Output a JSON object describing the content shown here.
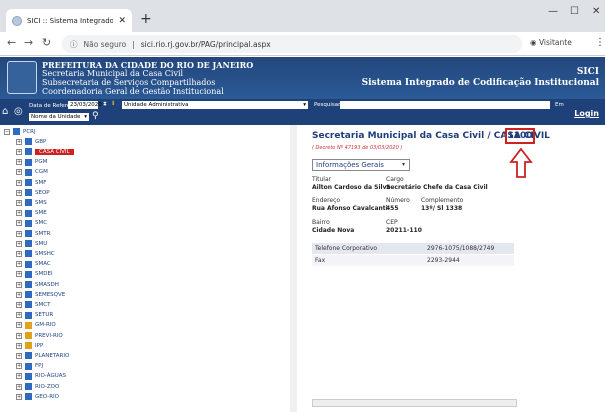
{
  "browser": {
    "tab_title": "SICI :: Sistema Integrado de Codi",
    "security": "Não seguro",
    "url": "sici.rio.rj.gov.br/PAG/principal.aspx",
    "profile": "Visitante"
  },
  "banner": {
    "line1": "PREFEITURA DA CIDADE DO RIO DE JANEIRO",
    "line2": "Secretaria Municipal da Casa Civil",
    "line3": "Subsecretaria de Serviços Compartilhados",
    "line4": "Coordenadoria Geral de Gestão Institucional",
    "right1": "SICI",
    "right2": "Sistema Integrado de Codificação Institucional"
  },
  "toolbar": {
    "ref_label": "Data de Referência",
    "ref_value": "23/03/2020",
    "unit_select": "Unidade Administrativa",
    "name_select": "Nome da Unidade",
    "search_label": "Pesquisar",
    "em_label": "Em",
    "login": "Login"
  },
  "tree": [
    "PCRJ",
    "GBP",
    "CASA CIVIL",
    "PGM",
    "CGM",
    "SMF",
    "SEOP",
    "SMS",
    "SME",
    "SMC",
    "SMTR",
    "SMU",
    "SMSHC",
    "SMAC",
    "SMDEI",
    "SMASDH",
    "SEMESQVE",
    "SMCT",
    "SETUR",
    "GM-RIO",
    "PREVI-RIO",
    "IPP",
    "PLANETARIO",
    "FPJ",
    "RIO-ÁGUAS",
    "RIO-ZOO",
    "GEO-RIO"
  ],
  "detail": {
    "title": "Secretaria Municipal da Casa Civil / CASA CIVIL",
    "code": "1100",
    "decreto": "( Decreto Nº 47193 de 03/03/2020 )",
    "info_select": "Informações Gerais",
    "titular_label": "Titular",
    "titular": "Ailton Cardoso da Silva",
    "cargo_label": "Cargo",
    "cargo": "Secretário Chefe da Casa Civil",
    "endereco_label": "Endereço",
    "endereco": "Rua Afonso Cavalcanti",
    "numero_label": "Número",
    "numero": "455",
    "complemento_label": "Complemento",
    "complemento": "13º/ Sl 1338",
    "bairro_label": "Bairro",
    "bairro": "Cidade Nova",
    "cep_label": "CEP",
    "cep": "20211-110",
    "tel_label": "Telefone Corporativo",
    "tel": "2976-1075/1088/2749",
    "fax_label": "Fax",
    "fax": "2293-2944"
  },
  "colors": {
    "banner": "#23477d",
    "toolbar": "#1f4179",
    "highlight": "#cc2222",
    "title": "#1e3d7a"
  }
}
